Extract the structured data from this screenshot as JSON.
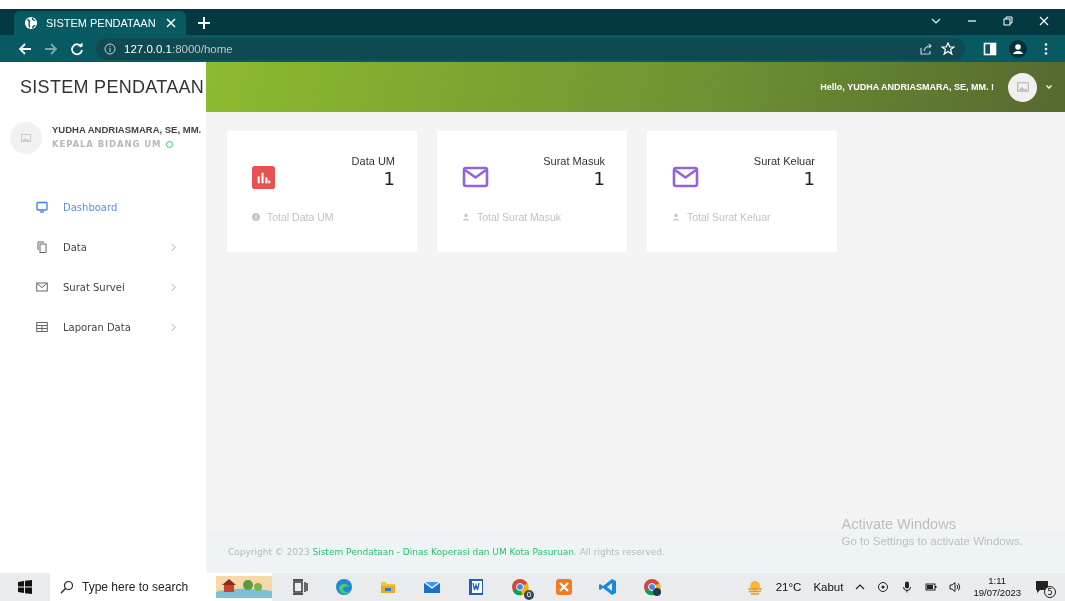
{
  "browser": {
    "tab_title": "SISTEM PENDATAAN",
    "url_host": "127.0.0.1",
    "url_path": ":8000/home"
  },
  "sidebar": {
    "brand": "SISTEM PENDATAAN",
    "user_name": "YUDHA ANDRIASMARA, SE, MM.",
    "user_role": "KEPALA BIDANG UM",
    "items": [
      {
        "label": "Dashboard",
        "kind": "monitor",
        "selected": true,
        "has_submenu": false
      },
      {
        "label": "Data",
        "kind": "copy",
        "selected": false,
        "has_submenu": true
      },
      {
        "label": "Surat Survei",
        "kind": "mail",
        "selected": false,
        "has_submenu": true
      },
      {
        "label": "Laporan Data",
        "kind": "table",
        "selected": false,
        "has_submenu": true
      }
    ]
  },
  "header": {
    "greeting": "Hello, YUDHA ANDRIASMARA, SE, MM. !"
  },
  "cards": [
    {
      "title": "Data UM",
      "value": "1",
      "kind": "chart",
      "caption": {
        "text": "Total Data UM",
        "kind": "info"
      }
    },
    {
      "title": "Surat Masuk",
      "value": "1",
      "kind": "mail",
      "caption": {
        "text": "Total Surat Masuk",
        "kind": "user"
      }
    },
    {
      "title": "Surat Keluar",
      "value": "1",
      "kind": "mail",
      "caption": {
        "text": "Total Surat Keluar",
        "kind": "user"
      }
    }
  ],
  "footer": {
    "prefix": "Copyright © 2023",
    "link": "Sistem Pendataan - Dinas Koperasi dan UM Kota Pasuruan",
    "suffix": ". All rights reserved."
  },
  "activation": {
    "title": "Activate Windows",
    "subtitle": "Go to Settings to activate Windows."
  },
  "taskbar": {
    "search_placeholder": "Type here to search",
    "chrome_badge": "0",
    "temperature": "21°C",
    "weather": "Kabut",
    "time": "1:11",
    "date": "19/07/2023",
    "notifications": "5"
  }
}
